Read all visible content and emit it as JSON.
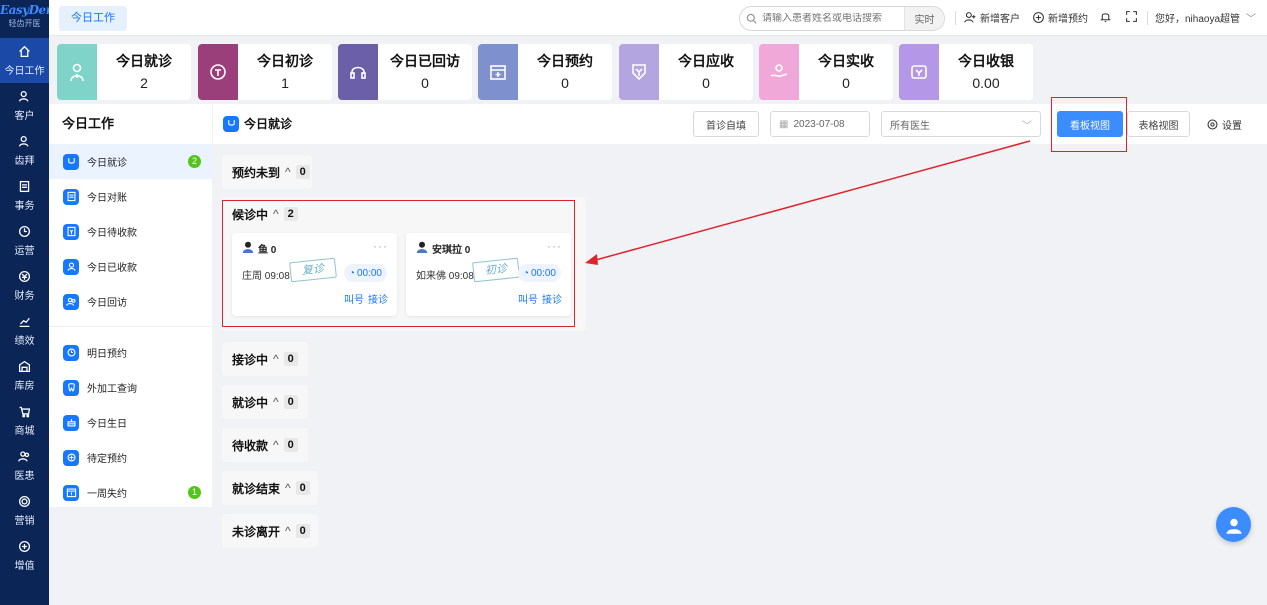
{
  "app": {
    "logo_top": "EasyDent",
    "logo_sub": "轻齿开医"
  },
  "leftnav": [
    {
      "label": "今日工作",
      "icon": "home-icon",
      "active": true
    },
    {
      "label": "客户",
      "icon": "user-icon"
    },
    {
      "label": "齿拜",
      "icon": "user-icon"
    },
    {
      "label": "事务",
      "icon": "document-icon"
    },
    {
      "label": "运营",
      "icon": "clock-icon"
    },
    {
      "label": "财务",
      "icon": "money-icon"
    },
    {
      "label": "绩效",
      "icon": "chart-icon"
    },
    {
      "label": "库房",
      "icon": "warehouse-icon"
    },
    {
      "label": "商城",
      "icon": "cart-icon"
    },
    {
      "label": "医患",
      "icon": "people-icon"
    },
    {
      "label": "营销",
      "icon": "target-icon"
    },
    {
      "label": "增值",
      "icon": "plus-circle-icon"
    }
  ],
  "topbar": {
    "tab": "今日工作",
    "search_placeholder": "请输入患者姓名或电话搜索",
    "search_mode": "实时",
    "new_customer": "新增客户",
    "new_appointment": "新增预约",
    "greeting": "您好，nihaoya超管"
  },
  "stats": [
    {
      "label": "今日就诊",
      "value": "2",
      "color": "#7fd3c8",
      "icon": "doctor-icon"
    },
    {
      "label": "今日初诊",
      "value": "1",
      "color": "#9b3f7a",
      "icon": "first-visit-icon"
    },
    {
      "label": "今日已回访",
      "value": "0",
      "color": "#6b5fa8",
      "icon": "headset-icon"
    },
    {
      "label": "今日预约",
      "value": "0",
      "color": "#7f90cf",
      "icon": "calendar-icon"
    },
    {
      "label": "今日应收",
      "value": "0",
      "color": "#b3a5e0",
      "icon": "receivable-icon"
    },
    {
      "label": "今日实收",
      "value": "0",
      "color": "#f0a8d8",
      "icon": "hand-coin-icon"
    },
    {
      "label": "今日收银",
      "value": "0.00",
      "color": "#b497e6",
      "icon": "cashier-icon"
    }
  ],
  "workpanel": {
    "title": "今日工作",
    "items": [
      {
        "label": "今日就诊",
        "badge": "2",
        "active": true
      },
      {
        "label": "今日对账"
      },
      {
        "label": "今日待收款"
      },
      {
        "label": "今日已收款"
      },
      {
        "label": "今日回访"
      },
      {
        "label": "明日预约"
      },
      {
        "label": "外加工查询"
      },
      {
        "label": "今日生日"
      },
      {
        "label": "待定预约"
      },
      {
        "label": "一周失约",
        "badge": "1"
      }
    ]
  },
  "main": {
    "title": "今日就诊",
    "btn_first_visit": "首诊自填",
    "date": "2023-07-08",
    "doctor_select": "所有医生",
    "btn_board_view": "看板视图",
    "btn_table_view": "表格视图",
    "settings": "设置"
  },
  "columns": [
    {
      "label": "预约未到",
      "count": "0"
    },
    {
      "label": "候诊中",
      "count": "2"
    },
    {
      "label": "接诊中",
      "count": "0"
    },
    {
      "label": "就诊中",
      "count": "0"
    },
    {
      "label": "待收款",
      "count": "0"
    },
    {
      "label": "就诊结束",
      "count": "0"
    },
    {
      "label": "未诊离开",
      "count": "0"
    }
  ],
  "cards": [
    {
      "name": "鱼 0",
      "meta": "庄周 09:08",
      "stamp": "复诊",
      "timer": "00:00",
      "call": "叫号",
      "receive": "接诊",
      "more": "···"
    },
    {
      "name": "安琪拉 0",
      "meta": "如来佛 09:08",
      "stamp": "初诊",
      "timer": "00:00",
      "call": "叫号",
      "receive": "接诊",
      "more": "···"
    }
  ]
}
